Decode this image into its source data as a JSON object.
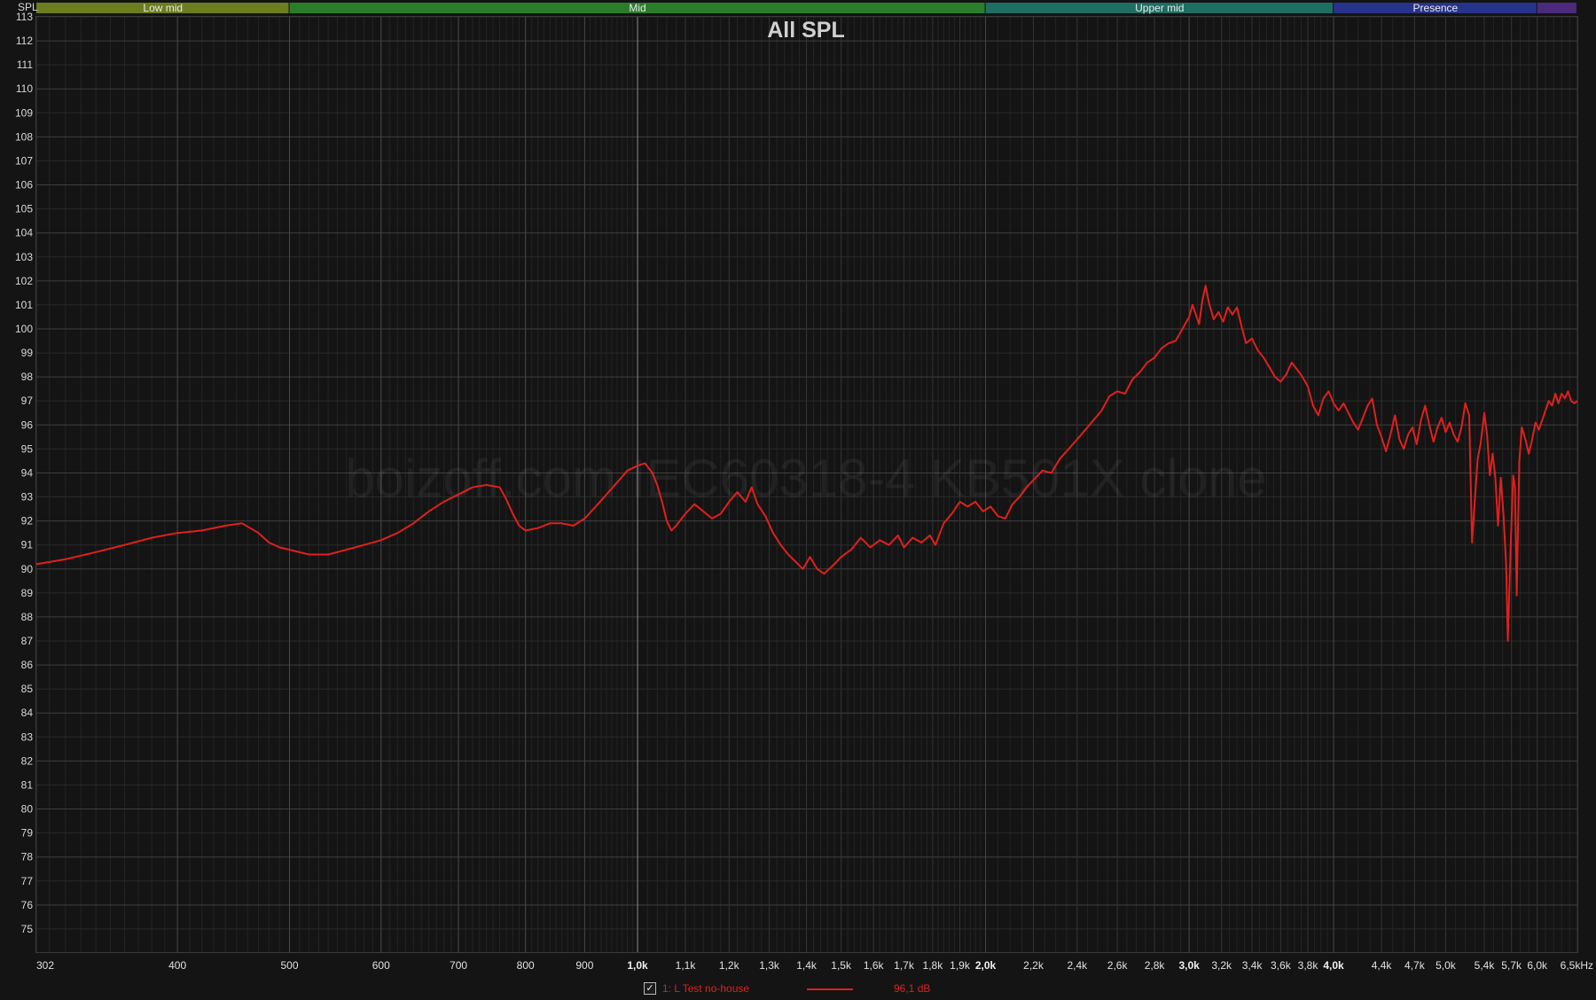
{
  "chart_data": {
    "type": "line",
    "title": "All SPL",
    "ylabel": "SPL",
    "xunit": "kHz",
    "xscale": "log",
    "xlim": [
      302,
      6500
    ],
    "ylim": [
      74,
      113
    ],
    "grid": true,
    "watermark": "boizoff.com IEC60318-4 KB501X clone",
    "yticks": [
      113,
      112,
      111,
      110,
      109,
      108,
      107,
      106,
      105,
      104,
      103,
      102,
      101,
      100,
      99,
      98,
      97,
      96,
      95,
      94,
      93,
      92,
      91,
      90,
      89,
      88,
      87,
      86,
      85,
      84,
      83,
      82,
      81,
      80,
      79,
      78,
      77,
      76,
      75
    ],
    "xticks": [
      {
        "value": 302,
        "label": "302"
      },
      {
        "value": 400,
        "label": "400"
      },
      {
        "value": 500,
        "label": "500"
      },
      {
        "value": 600,
        "label": "600"
      },
      {
        "value": 700,
        "label": "700"
      },
      {
        "value": 800,
        "label": "800"
      },
      {
        "value": 900,
        "label": "900"
      },
      {
        "value": 1000,
        "label": "1,0k"
      },
      {
        "value": 1100,
        "label": "1,1k"
      },
      {
        "value": 1200,
        "label": "1,2k"
      },
      {
        "value": 1300,
        "label": "1,3k"
      },
      {
        "value": 1400,
        "label": "1,4k"
      },
      {
        "value": 1500,
        "label": "1,5k"
      },
      {
        "value": 1600,
        "label": "1,6k"
      },
      {
        "value": 1700,
        "label": "1,7k"
      },
      {
        "value": 1800,
        "label": "1,8k"
      },
      {
        "value": 1900,
        "label": "1,9k"
      },
      {
        "value": 2000,
        "label": "2,0k"
      },
      {
        "value": 2200,
        "label": "2,2k"
      },
      {
        "value": 2400,
        "label": "2,4k"
      },
      {
        "value": 2600,
        "label": "2,6k"
      },
      {
        "value": 2800,
        "label": "2,8k"
      },
      {
        "value": 3000,
        "label": "3,0k"
      },
      {
        "value": 3200,
        "label": "3,2k"
      },
      {
        "value": 3400,
        "label": "3,4k"
      },
      {
        "value": 3600,
        "label": "3,6k"
      },
      {
        "value": 3800,
        "label": "3,8k"
      },
      {
        "value": 4000,
        "label": "4,0k"
      },
      {
        "value": 4400,
        "label": "4,4k"
      },
      {
        "value": 4700,
        "label": "4,7k"
      },
      {
        "value": 5000,
        "label": "5,0k"
      },
      {
        "value": 5400,
        "label": "5,4k"
      },
      {
        "value": 5700,
        "label": "5,7k"
      },
      {
        "value": 6000,
        "label": "6,0k"
      },
      {
        "value": 6500,
        "label": "6,5kHz"
      }
    ],
    "bands": [
      {
        "label": "Low mid",
        "from": 302,
        "to": 500,
        "color": "#6b7d1e"
      },
      {
        "label": "Mid",
        "from": 500,
        "to": 2000,
        "color": "#2a7d2a"
      },
      {
        "label": "Upper mid",
        "from": 2000,
        "to": 4000,
        "color": "#1e6e63"
      },
      {
        "label": "Presence",
        "from": 4000,
        "to": 6000,
        "color": "#27338a"
      },
      {
        "label": "",
        "from": 6000,
        "to": 6500,
        "color": "#4b2a7d"
      }
    ],
    "series": [
      {
        "name": "1: L Test no-house",
        "color": "#e0201c",
        "value_label": "96,1 dB",
        "points": [
          [
            302,
            90.2
          ],
          [
            320,
            90.4
          ],
          [
            340,
            90.7
          ],
          [
            360,
            91.0
          ],
          [
            380,
            91.3
          ],
          [
            400,
            91.5
          ],
          [
            420,
            91.6
          ],
          [
            440,
            91.8
          ],
          [
            455,
            91.9
          ],
          [
            470,
            91.5
          ],
          [
            480,
            91.1
          ],
          [
            490,
            90.9
          ],
          [
            500,
            90.8
          ],
          [
            520,
            90.6
          ],
          [
            540,
            90.6
          ],
          [
            560,
            90.8
          ],
          [
            580,
            91.0
          ],
          [
            600,
            91.2
          ],
          [
            620,
            91.5
          ],
          [
            640,
            91.9
          ],
          [
            660,
            92.4
          ],
          [
            680,
            92.8
          ],
          [
            700,
            93.1
          ],
          [
            720,
            93.4
          ],
          [
            740,
            93.5
          ],
          [
            760,
            93.4
          ],
          [
            770,
            92.9
          ],
          [
            780,
            92.3
          ],
          [
            790,
            91.8
          ],
          [
            800,
            91.6
          ],
          [
            820,
            91.7
          ],
          [
            840,
            91.9
          ],
          [
            860,
            91.9
          ],
          [
            880,
            91.8
          ],
          [
            900,
            92.1
          ],
          [
            920,
            92.6
          ],
          [
            940,
            93.1
          ],
          [
            960,
            93.6
          ],
          [
            980,
            94.1
          ],
          [
            1000,
            94.3
          ],
          [
            1015,
            94.4
          ],
          [
            1030,
            94.0
          ],
          [
            1040,
            93.5
          ],
          [
            1050,
            92.8
          ],
          [
            1060,
            92.0
          ],
          [
            1070,
            91.6
          ],
          [
            1080,
            91.8
          ],
          [
            1100,
            92.3
          ],
          [
            1120,
            92.7
          ],
          [
            1140,
            92.4
          ],
          [
            1160,
            92.1
          ],
          [
            1180,
            92.3
          ],
          [
            1200,
            92.8
          ],
          [
            1220,
            93.2
          ],
          [
            1240,
            92.8
          ],
          [
            1255,
            93.4
          ],
          [
            1270,
            92.7
          ],
          [
            1290,
            92.2
          ],
          [
            1310,
            91.5
          ],
          [
            1330,
            91.0
          ],
          [
            1350,
            90.6
          ],
          [
            1370,
            90.3
          ],
          [
            1390,
            90.0
          ],
          [
            1410,
            90.5
          ],
          [
            1430,
            90.0
          ],
          [
            1450,
            89.8
          ],
          [
            1480,
            90.2
          ],
          [
            1500,
            90.5
          ],
          [
            1530,
            90.8
          ],
          [
            1560,
            91.3
          ],
          [
            1590,
            90.9
          ],
          [
            1620,
            91.2
          ],
          [
            1650,
            91.0
          ],
          [
            1680,
            91.4
          ],
          [
            1700,
            90.9
          ],
          [
            1730,
            91.3
          ],
          [
            1760,
            91.1
          ],
          [
            1790,
            91.4
          ],
          [
            1810,
            91.0
          ],
          [
            1840,
            91.9
          ],
          [
            1870,
            92.3
          ],
          [
            1900,
            92.8
          ],
          [
            1930,
            92.6
          ],
          [
            1960,
            92.8
          ],
          [
            1990,
            92.4
          ],
          [
            2020,
            92.6
          ],
          [
            2050,
            92.2
          ],
          [
            2080,
            92.1
          ],
          [
            2110,
            92.7
          ],
          [
            2140,
            93.0
          ],
          [
            2170,
            93.4
          ],
          [
            2200,
            93.7
          ],
          [
            2240,
            94.1
          ],
          [
            2280,
            94.0
          ],
          [
            2320,
            94.6
          ],
          [
            2360,
            95.0
          ],
          [
            2400,
            95.4
          ],
          [
            2440,
            95.8
          ],
          [
            2480,
            96.2
          ],
          [
            2520,
            96.6
          ],
          [
            2560,
            97.2
          ],
          [
            2600,
            97.4
          ],
          [
            2640,
            97.3
          ],
          [
            2680,
            97.9
          ],
          [
            2720,
            98.2
          ],
          [
            2760,
            98.6
          ],
          [
            2800,
            98.8
          ],
          [
            2840,
            99.2
          ],
          [
            2880,
            99.4
          ],
          [
            2920,
            99.5
          ],
          [
            2960,
            100.0
          ],
          [
            3000,
            100.5
          ],
          [
            3020,
            101.0
          ],
          [
            3040,
            100.6
          ],
          [
            3060,
            100.2
          ],
          [
            3080,
            101.2
          ],
          [
            3100,
            101.8
          ],
          [
            3120,
            101.1
          ],
          [
            3150,
            100.4
          ],
          [
            3180,
            100.7
          ],
          [
            3210,
            100.3
          ],
          [
            3240,
            100.9
          ],
          [
            3270,
            100.6
          ],
          [
            3300,
            100.9
          ],
          [
            3330,
            100.1
          ],
          [
            3360,
            99.4
          ],
          [
            3400,
            99.6
          ],
          [
            3440,
            99.1
          ],
          [
            3480,
            98.8
          ],
          [
            3520,
            98.4
          ],
          [
            3560,
            98.0
          ],
          [
            3600,
            97.8
          ],
          [
            3640,
            98.1
          ],
          [
            3680,
            98.6
          ],
          [
            3720,
            98.3
          ],
          [
            3760,
            98.0
          ],
          [
            3800,
            97.6
          ],
          [
            3840,
            96.8
          ],
          [
            3880,
            96.4
          ],
          [
            3920,
            97.1
          ],
          [
            3960,
            97.4
          ],
          [
            4000,
            96.9
          ],
          [
            4040,
            96.6
          ],
          [
            4080,
            96.9
          ],
          [
            4120,
            96.5
          ],
          [
            4160,
            96.1
          ],
          [
            4200,
            95.8
          ],
          [
            4240,
            96.3
          ],
          [
            4280,
            96.8
          ],
          [
            4320,
            97.1
          ],
          [
            4360,
            96.0
          ],
          [
            4400,
            95.5
          ],
          [
            4440,
            94.9
          ],
          [
            4480,
            95.6
          ],
          [
            4520,
            96.4
          ],
          [
            4560,
            95.4
          ],
          [
            4600,
            95.0
          ],
          [
            4640,
            95.6
          ],
          [
            4680,
            95.9
          ],
          [
            4720,
            95.2
          ],
          [
            4760,
            96.2
          ],
          [
            4800,
            96.8
          ],
          [
            4840,
            96.0
          ],
          [
            4880,
            95.3
          ],
          [
            4920,
            95.9
          ],
          [
            4960,
            96.3
          ],
          [
            5000,
            95.7
          ],
          [
            5040,
            96.1
          ],
          [
            5080,
            95.6
          ],
          [
            5120,
            95.3
          ],
          [
            5160,
            95.9
          ],
          [
            5200,
            96.9
          ],
          [
            5240,
            96.4
          ],
          [
            5270,
            91.1
          ],
          [
            5300,
            92.9
          ],
          [
            5330,
            94.6
          ],
          [
            5360,
            95.2
          ],
          [
            5400,
            96.5
          ],
          [
            5430,
            95.6
          ],
          [
            5460,
            93.9
          ],
          [
            5490,
            94.8
          ],
          [
            5520,
            93.8
          ],
          [
            5550,
            91.8
          ],
          [
            5580,
            93.8
          ],
          [
            5610,
            92.3
          ],
          [
            5640,
            90.2
          ],
          [
            5660,
            87.0
          ],
          [
            5690,
            90.8
          ],
          [
            5720,
            93.9
          ],
          [
            5740,
            93.4
          ],
          [
            5760,
            88.9
          ],
          [
            5790,
            94.5
          ],
          [
            5820,
            95.9
          ],
          [
            5860,
            95.4
          ],
          [
            5900,
            94.8
          ],
          [
            5940,
            95.4
          ],
          [
            5980,
            96.1
          ],
          [
            6020,
            95.8
          ],
          [
            6060,
            96.2
          ],
          [
            6100,
            96.6
          ],
          [
            6140,
            97.0
          ],
          [
            6180,
            96.8
          ],
          [
            6220,
            97.3
          ],
          [
            6260,
            96.9
          ],
          [
            6300,
            97.3
          ],
          [
            6340,
            97.1
          ],
          [
            6380,
            97.4
          ],
          [
            6420,
            97.0
          ],
          [
            6460,
            96.9
          ],
          [
            6500,
            97.0
          ]
        ]
      }
    ]
  }
}
